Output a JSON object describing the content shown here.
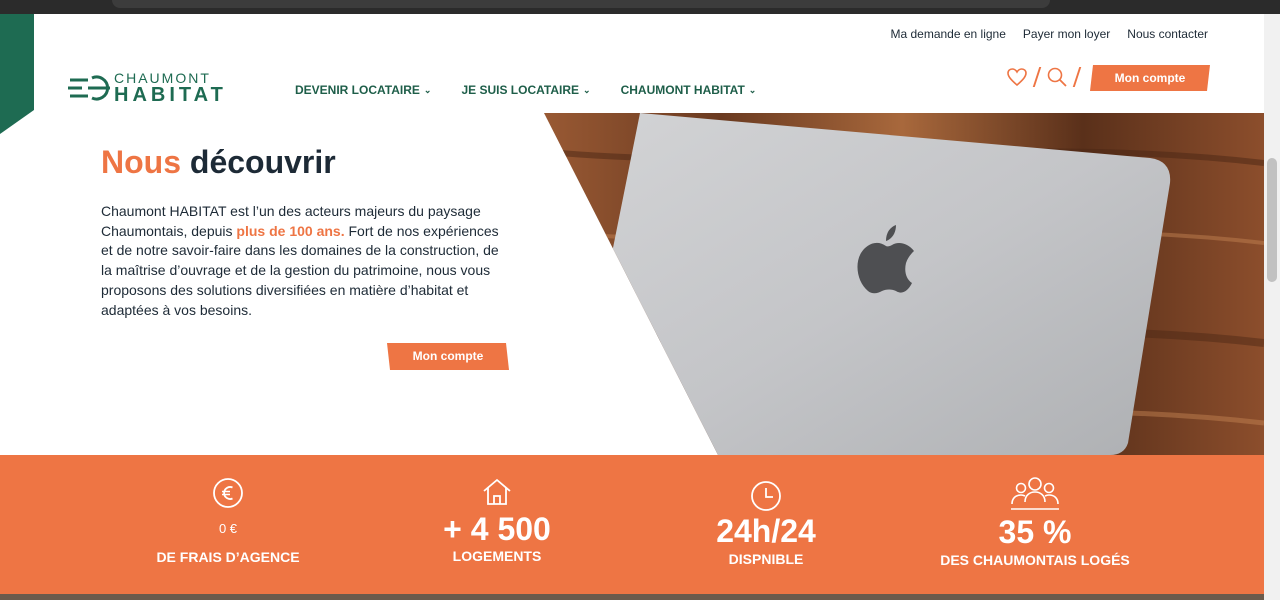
{
  "header": {
    "top_links": [
      "Ma demande en ligne",
      "Payer mon loyer",
      "Nous contacter"
    ],
    "logo": {
      "line1": "CHAUMONT",
      "line2": "HABITAT"
    },
    "nav": [
      "DEVENIR LOCATAIRE",
      "JE SUIS LOCATAIRE",
      "CHAUMONT HABITAT"
    ],
    "account_button": "Mon compte"
  },
  "hero": {
    "title_part1": "Nous",
    "title_part2": "découvrir",
    "text_before": "Chaumont HABITAT est l’un des acteurs majeurs du paysage Chaumontais, depuis ",
    "text_highlight": "plus de 100 ans.",
    "text_after": " Fort de nos expériences et de notre savoir-faire dans les domaines de la construction, de la maîtrise d’ouvrage et de la gestion du patrimoine, nous vous proposons des solutions diversifiées en matière d’habitat et adaptées à vos besoins.",
    "button": "Mon compte"
  },
  "stats": [
    {
      "icon": "euro-icon",
      "value": "0 €",
      "label": "DE FRAIS D’AGENCE"
    },
    {
      "icon": "house-icon",
      "value": "+ 4 500",
      "label": "LOGEMENTS"
    },
    {
      "icon": "clock-icon",
      "value": "24h/24",
      "label": "DISPNIBLE"
    },
    {
      "icon": "people-icon",
      "value": "35 %",
      "label": "DES CHAUMONTAIS LOGÉS"
    }
  ],
  "colors": {
    "accent": "#ee7544",
    "brand_green": "#1e6b52",
    "dark": "#1d2a36"
  },
  "icons": [
    "heart-icon",
    "search-icon"
  ]
}
